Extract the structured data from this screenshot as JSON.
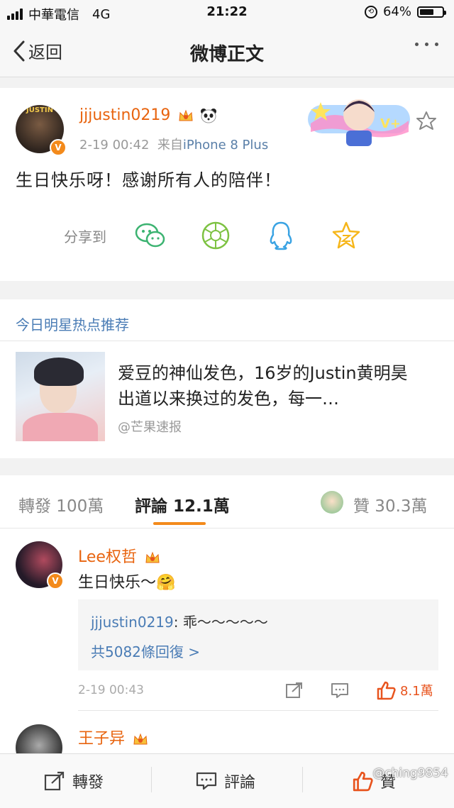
{
  "status_bar": {
    "carrier": "中華電信",
    "network": "4G",
    "time": "21:22",
    "battery": "64%",
    "battery_level": 0.64
  },
  "nav": {
    "back_label": "返回",
    "title": "微博正文"
  },
  "post": {
    "username": "jjjustin0219",
    "avatar_text": "JUSTIN",
    "verified": "V",
    "time": "2-19 00:42",
    "source_prefix": "来自",
    "source": "iPhone 8 Plus",
    "content": "生日快乐呀！感谢所有人的陪伴！",
    "share_label": "分享到",
    "share_targets": [
      "wechat-icon",
      "moments-icon",
      "qq-icon",
      "qzone-icon"
    ]
  },
  "recommend": {
    "header": "今日明星热点推荐",
    "title": "爱豆的神仙发色，16岁的Justin黄明昊出道以来换过的发色，每一…",
    "source": "@芒果速报"
  },
  "tabs": {
    "repost": "轉發 100萬",
    "comment": "評論 12.1萬",
    "like": "贊 30.3萬"
  },
  "comments": [
    {
      "username": "Lee权哲",
      "text": "生日快乐～🤗",
      "reply_user": "jjjustin0219",
      "reply_text": "乖～～～～～",
      "reply_count": "共5082條回復 >",
      "time": "2-19 00:43",
      "likes": "8.1萬"
    },
    {
      "username": "王子异"
    }
  ],
  "bottom": {
    "repost": "轉發",
    "comment": "評論",
    "like": "贊"
  },
  "watermark": "@ching9854",
  "colors": {
    "accent": "#f38a1b",
    "username": "#e8640f",
    "link": "#4a7cb5",
    "like": "#e8541e"
  }
}
